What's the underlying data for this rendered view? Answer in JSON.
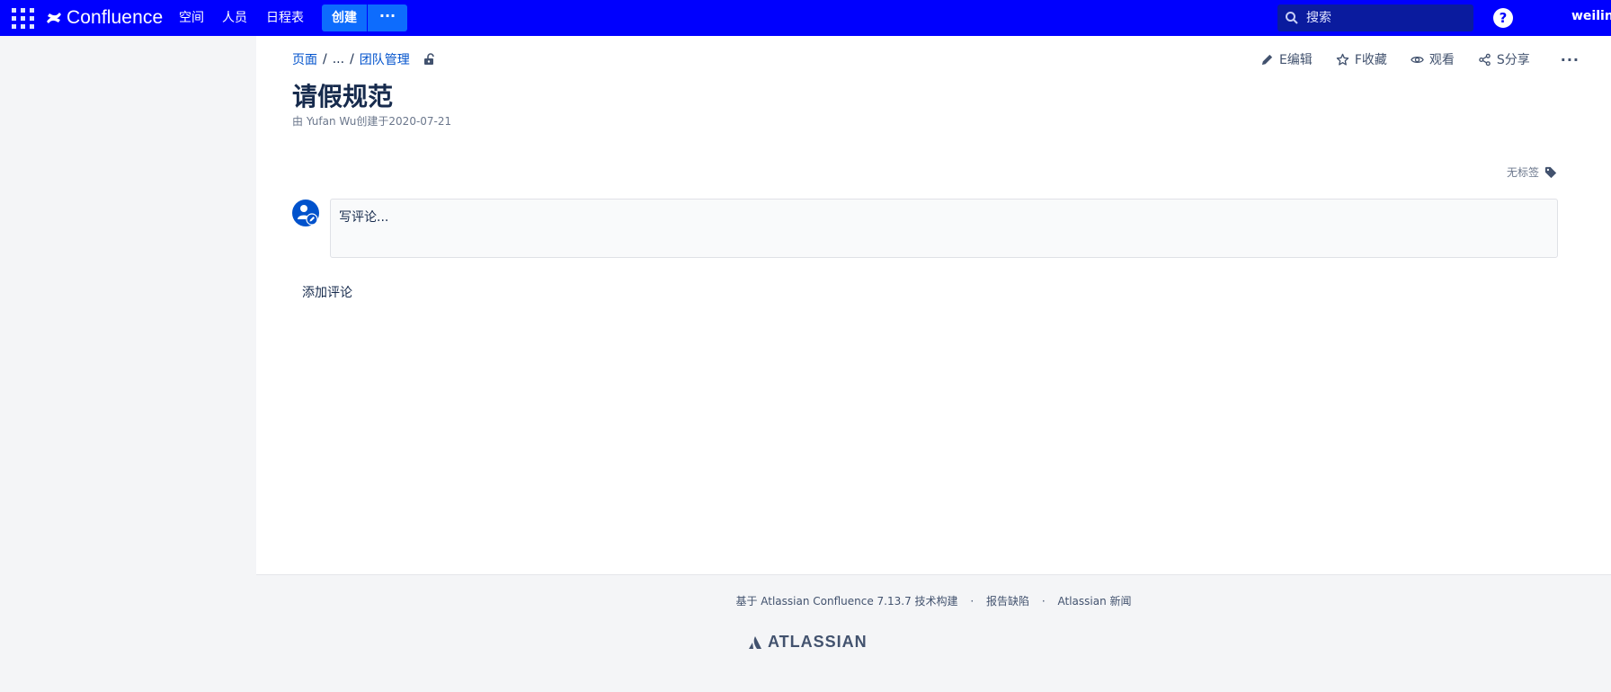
{
  "topbar": {
    "app_name": "Confluence",
    "nav": [
      "空间",
      "人员",
      "日程表"
    ],
    "create_label": "创建",
    "more_label": "···",
    "search_placeholder": "搜索",
    "help_label": "?",
    "user": "weiling"
  },
  "colors": {
    "topbar_bg": "#0000fe",
    "create_bg": "#0d6cfd",
    "link": "#0052cc"
  },
  "breadcrumb": {
    "items": [
      "页面",
      "...",
      "团队管理"
    ]
  },
  "actions": {
    "edit": "E编辑",
    "favorite": "F收藏",
    "watch": "观看",
    "share": "S分享",
    "more": "···"
  },
  "page": {
    "title": "请假规范",
    "byline": "由 Yufan Wu创建于2020-07-21",
    "labels": "无标签"
  },
  "comment": {
    "placeholder": "写评论...",
    "add_label": "添加评论"
  },
  "footer": {
    "powered": "基于 Atlassian Confluence 7.13.7 技术构建",
    "report_bug": "报告缺陷",
    "news": "Atlassian 新闻",
    "logo_text": "ATLASSIAN"
  }
}
